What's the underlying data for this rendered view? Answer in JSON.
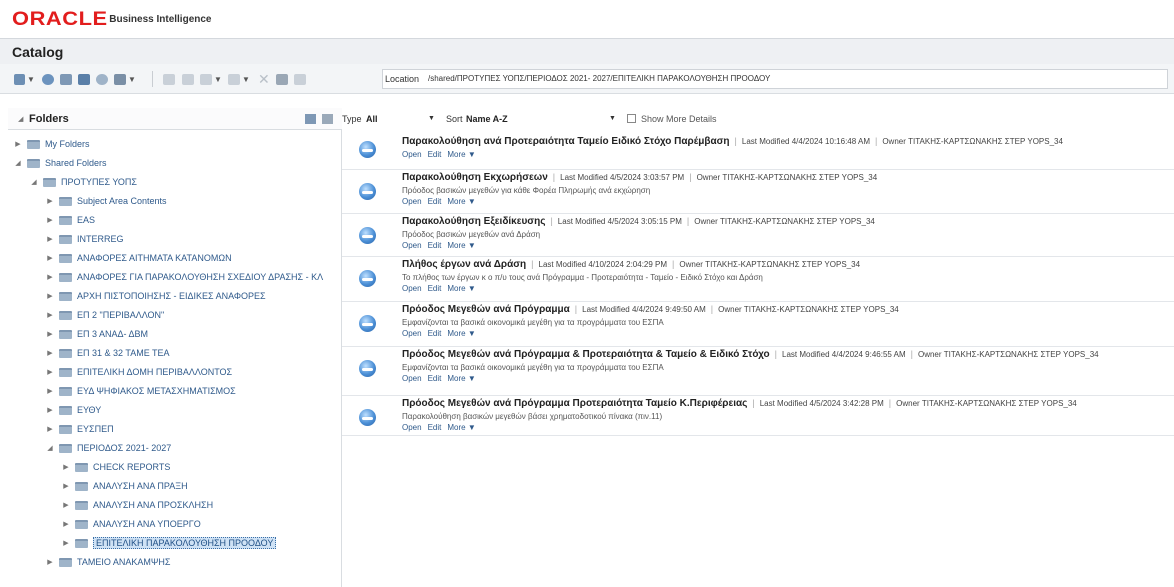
{
  "header": {
    "brand": "ORACLE",
    "product": "Business Intelligence",
    "page_title": "Catalog"
  },
  "toolbar": {
    "location_label": "Location",
    "location_path": "/shared/ΠΡΟΤΥΠΕΣ ΥΟΠΣ/ΠΕΡΙΟΔΟΣ 2021- 2027/ΕΠΙΤΕΛΙΚΗ ΠΑΡΑΚΟΛΟΥΘΗΣΗ ΠΡΟΟΔΟΥ"
  },
  "folders": {
    "title": "Folders",
    "tree": [
      {
        "label": "My Folders",
        "expanded": false
      },
      {
        "label": "Shared Folders",
        "expanded": true
      },
      {
        "label": "ΠΡΟΤΥΠΕΣ ΥΟΠΣ",
        "expanded": true
      },
      {
        "label": "Subject Area Contents",
        "expanded": false
      },
      {
        "label": "EAS",
        "expanded": false
      },
      {
        "label": "INTERREG",
        "expanded": false
      },
      {
        "label": "ΑΝΑΦΟΡΕΣ ΑΙΤΗΜΑΤΑ ΚΑΤΑΝΟΜΩΝ",
        "expanded": false
      },
      {
        "label": "ΑΝΑΦΟΡΕΣ ΓΙΑ ΠΑΡΑΚΟΛΟΥΘΗΣΗ ΣΧΕΔΙΟΥ ΔΡΑΣΗΣ - ΚΛ",
        "expanded": false
      },
      {
        "label": "ΑΡΧΗ ΠΙΣΤΟΠΟΙΗΣΗΣ - ΕΙΔΙΚΕΣ ΑΝΑΦΟΡΕΣ",
        "expanded": false
      },
      {
        "label": "ΕΠ 2 \"ΠΕΡΙΒΑΛΛΟΝ\"",
        "expanded": false
      },
      {
        "label": "ΕΠ 3 ΑΝΑΔ- ΔΒΜ",
        "expanded": false
      },
      {
        "label": "ΕΠ 31 & 32 ΤΑΜΕ ΤΕΑ",
        "expanded": false
      },
      {
        "label": "ΕΠΙΤΕΛΙΚΗ ΔΟΜΗ ΠΕΡΙΒΑΛΛΟΝΤΟΣ",
        "expanded": false
      },
      {
        "label": "ΕΥΔ ΨΗΦΙΑΚΟΣ ΜΕΤΑΣΧΗΜΑΤΙΣΜΟΣ",
        "expanded": false
      },
      {
        "label": "ΕΥΘΥ",
        "expanded": false
      },
      {
        "label": "ΕΥΣΠΕΠ",
        "expanded": false
      },
      {
        "label": "ΠΕΡΙΟΔΟΣ 2021- 2027",
        "expanded": true
      },
      {
        "label": "CHECK REPORTS",
        "expanded": false
      },
      {
        "label": "ΑΝΑΛΥΣΗ ΑΝΑ ΠΡΑΞΗ",
        "expanded": false
      },
      {
        "label": "ΑΝΑΛΥΣΗ ΑΝΑ ΠΡΟΣΚΛΗΣΗ",
        "expanded": false
      },
      {
        "label": "ΑΝΑΛΥΣΗ ΑΝΑ ΥΠΟΕΡΓΟ",
        "expanded": false
      },
      {
        "label": "ΕΠΙΤΕΛΙΚΗ ΠΑΡΑΚΟΛΟΥΘΗΣΗ ΠΡΟΟΔΟΥ",
        "expanded": false,
        "selected": true
      },
      {
        "label": "ΤΑΜΕΙΟ ΑΝΑΚΑΜΨΗΣ",
        "expanded": false
      }
    ]
  },
  "filter": {
    "type_label": "Type",
    "type_value": "All",
    "sort_label": "Sort",
    "sort_value": "Name A-Z",
    "show_more_label": "Show More Details"
  },
  "items": [
    {
      "title": "Παρακολούθηση ανά Προτεραιότητα Ταμείο Ειδικό Στόχο Παρέμβαση",
      "modified": "Last Modified 4/4/2024 10:16:48 AM",
      "owner": "Owner ΤΙΤΑΚΗΣ-ΚΑΡΤΣΩΝΑΚΗΣ ΣΤΕΡ YOPS_34",
      "desc": "",
      "open": "Open",
      "edit": "Edit",
      "more": "More ▼"
    },
    {
      "title": "Παρακολούθηση Εκχωρήσεων",
      "modified": "Last Modified 4/5/2024 3:03:57 PM",
      "owner": "Owner ΤΙΤΑΚΗΣ-ΚΑΡΤΣΩΝΑΚΗΣ ΣΤΕΡ YOPS_34",
      "desc": "Πρόοδος βασικών μεγεθών για κάθε Φορέα Πληρωμής ανά εκχώρηση",
      "open": "Open",
      "edit": "Edit",
      "more": "More ▼"
    },
    {
      "title": "Παρακολούθηση Εξειδίκευσης",
      "modified": "Last Modified 4/5/2024 3:05:15 PM",
      "owner": "Owner ΤΙΤΑΚΗΣ-ΚΑΡΤΣΩΝΑΚΗΣ ΣΤΕΡ YOPS_34",
      "desc": "Πρόοδος βασικών μεγεθών ανά Δράση",
      "open": "Open",
      "edit": "Edit",
      "more": "More ▼"
    },
    {
      "title": "Πλήθος έργων ανά Δράση",
      "modified": "Last Modified 4/10/2024 2:04:29 PM",
      "owner": "Owner ΤΙΤΑΚΗΣ-ΚΑΡΤΣΩΝΑΚΗΣ ΣΤΕΡ YOPS_34",
      "desc": "Το πλήθος των έργων κ ο π/υ τους ανά Πρόγραμμα - Προτεραιότητα - Ταμείο - Ειδικό Στόχο και Δράση",
      "open": "Open",
      "edit": "Edit",
      "more": "More ▼"
    },
    {
      "title": "Πρόοδος Μεγεθών ανά Πρόγραμμα",
      "modified": "Last Modified 4/4/2024 9:49:50 AM",
      "owner": "Owner ΤΙΤΑΚΗΣ-ΚΑΡΤΣΩΝΑΚΗΣ ΣΤΕΡ YOPS_34",
      "desc": "Εμφανίζονται τα βασικά οικονομικά μεγέθη για τα προγράμματα του ΕΣΠΑ",
      "open": "Open",
      "edit": "Edit",
      "more": "More ▼"
    },
    {
      "title": "Πρόοδος Μεγεθών ανά Πρόγραμμα & Προτεραιότητα & Ταμείο & Ειδικό Στόχο",
      "modified": "Last Modified 4/4/2024 9:46:55 AM",
      "owner": "Owner ΤΙΤΑΚΗΣ-ΚΑΡΤΣΩΝΑΚΗΣ ΣΤΕΡ YOPS_34",
      "desc": "Εμφανίζονται τα βασικά οικονομικά μεγέθη για τα προγράμματα του ΕΣΠΑ",
      "open": "Open",
      "edit": "Edit",
      "more": "More ▼"
    },
    {
      "title": "Πρόοδος Μεγεθών ανά Πρόγραμμα Προτεραιότητα Ταμείο Κ.Περιφέρειας",
      "modified": "Last Modified 4/5/2024 3:42:28 PM",
      "owner": "Owner ΤΙΤΑΚΗΣ-ΚΑΡΤΣΩΝΑΚΗΣ ΣΤΕΡ YOPS_34",
      "desc": "Παρακολούθηση βασικών μεγεθών βάσει χρηματοδοτικού πίνακα (πιν.11)",
      "open": "Open",
      "edit": "Edit",
      "more": "More ▼"
    }
  ]
}
